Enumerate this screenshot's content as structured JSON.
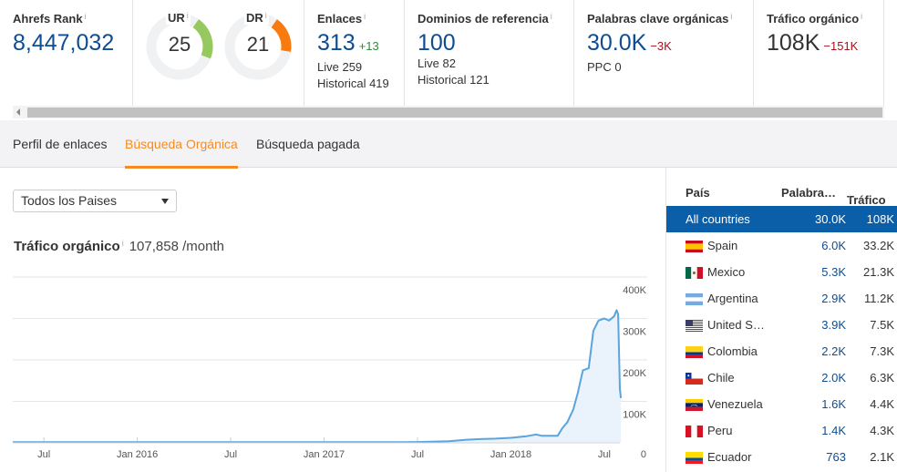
{
  "metrics": {
    "ahrefs_rank": {
      "label": "Ahrefs Rank",
      "value": "8,447,032"
    },
    "ur": {
      "label": "UR",
      "value": "25",
      "fraction": 0.25,
      "color": "#95c95f"
    },
    "dr": {
      "label": "DR",
      "value": "21",
      "fraction": 0.21,
      "color": "#f77b0f"
    },
    "enlaces": {
      "label": "Enlaces",
      "value": "313",
      "delta": "+13",
      "live": "Live 259",
      "historical": "Historical 419"
    },
    "dominios": {
      "label": "Dominios de referencia",
      "value": "100",
      "live": "Live 82",
      "historical": "Historical 121"
    },
    "palabras": {
      "label": "Palabras clave orgánicas",
      "value": "30.0K",
      "delta": "−3K",
      "ppc": "PPC 0"
    },
    "trafico": {
      "label": "Tráfico orgánico",
      "value": "108K",
      "delta": "−151K"
    }
  },
  "info_glyph": "i",
  "tabs": [
    {
      "label": "Perfil de enlaces",
      "active": false
    },
    {
      "label": "Búsqueda Orgánica",
      "active": true
    },
    {
      "label": "Búsqueda pagada",
      "active": false
    }
  ],
  "country_select": {
    "value": "Todos los Paises"
  },
  "traffic_summary": {
    "title": "Tráfico orgánico",
    "value": "107,858 /month"
  },
  "chart_data": {
    "type": "area",
    "title": "Tráfico orgánico",
    "xlabel": "",
    "ylabel": "",
    "x_tick_labels": [
      "Jul",
      "Jan 2016",
      "Jul",
      "Jan 2017",
      "Jul",
      "Jan 2018",
      "Jul"
    ],
    "y_tick_labels": [
      "0",
      "100K",
      "200K",
      "300K",
      "400K"
    ],
    "ylim": [
      0,
      400000
    ],
    "x_range": [
      "2015-05",
      "2018-08"
    ],
    "grid": true,
    "color": "#5ba4dc",
    "series": [
      {
        "name": "Organic traffic",
        "points": [
          [
            "2015-05",
            1500
          ],
          [
            "2015-07",
            1500
          ],
          [
            "2016-01",
            1500
          ],
          [
            "2016-07",
            1500
          ],
          [
            "2017-01",
            1500
          ],
          [
            "2017-06",
            1500
          ],
          [
            "2017-07",
            2000
          ],
          [
            "2017-09",
            4000
          ],
          [
            "2017-10",
            7000
          ],
          [
            "2017-11",
            9000
          ],
          [
            "2017-12",
            10000
          ],
          [
            "2018-01",
            12000
          ],
          [
            "2018-02",
            16000
          ],
          [
            "2018-02-20",
            20000
          ],
          [
            "2018-03",
            17000
          ],
          [
            "2018-04",
            17000
          ],
          [
            "2018-04-10",
            35000
          ],
          [
            "2018-04-20",
            50000
          ],
          [
            "2018-05",
            80000
          ],
          [
            "2018-05-10",
            120000
          ],
          [
            "2018-05-20",
            175000
          ],
          [
            "2018-06",
            180000
          ],
          [
            "2018-06-10",
            270000
          ],
          [
            "2018-06-20",
            295000
          ],
          [
            "2018-07",
            300000
          ],
          [
            "2018-07-10",
            295000
          ],
          [
            "2018-07-20",
            305000
          ],
          [
            "2018-07-25",
            320000
          ],
          [
            "2018-07-28",
            310000
          ],
          [
            "2018-08-01",
            130000
          ],
          [
            "2018-08-03",
            108000
          ]
        ]
      }
    ]
  },
  "country_table": {
    "headers": {
      "country": "País",
      "keywords": "Palabra…",
      "traffic": "Tráfico"
    },
    "rows": [
      {
        "flag": "all",
        "name": "All countries",
        "keywords": "30.0K",
        "traffic": "108K",
        "selected": true
      },
      {
        "flag": "es",
        "name": "Spain",
        "keywords": "6.0K",
        "traffic": "33.2K"
      },
      {
        "flag": "mx",
        "name": "Mexico",
        "keywords": "5.3K",
        "traffic": "21.3K"
      },
      {
        "flag": "ar",
        "name": "Argentina",
        "keywords": "2.9K",
        "traffic": "11.2K"
      },
      {
        "flag": "us",
        "name": "United S…",
        "keywords": "3.9K",
        "traffic": "7.5K"
      },
      {
        "flag": "co",
        "name": "Colombia",
        "keywords": "2.2K",
        "traffic": "7.3K"
      },
      {
        "flag": "cl",
        "name": "Chile",
        "keywords": "2.0K",
        "traffic": "6.3K"
      },
      {
        "flag": "ve",
        "name": "Venezuela",
        "keywords": "1.6K",
        "traffic": "4.4K"
      },
      {
        "flag": "pe",
        "name": "Peru",
        "keywords": "1.4K",
        "traffic": "4.3K"
      },
      {
        "flag": "ec",
        "name": "Ecuador",
        "keywords": "763",
        "traffic": "2.1K"
      }
    ]
  }
}
